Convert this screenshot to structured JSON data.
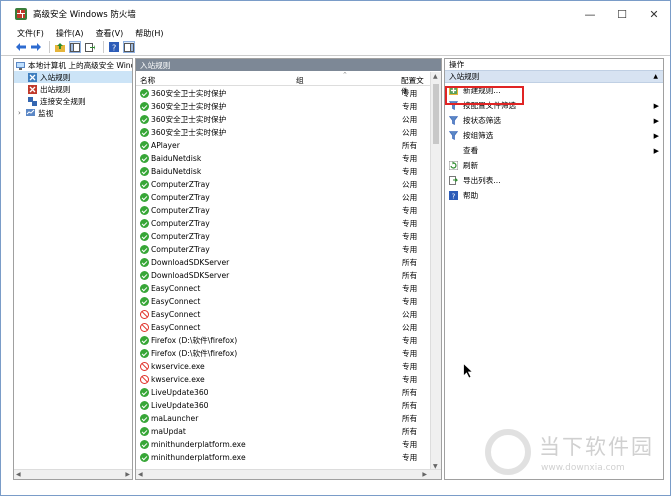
{
  "window": {
    "title": "高级安全 Windows 防火墙",
    "minimize": "—",
    "maximize": "☐",
    "close": "✕"
  },
  "menu": [
    "文件(F)",
    "操作(A)",
    "查看(V)",
    "帮助(H)"
  ],
  "tree": {
    "root": "本地计算机 上的高级安全 Windows",
    "items": [
      "入站规则",
      "出站规则",
      "连接安全规则",
      "监视"
    ]
  },
  "center": {
    "header": "入站规则",
    "columns": {
      "name": "名称",
      "group": "组",
      "profile": "配置文件"
    },
    "rows": [
      {
        "name": "360安全卫士实时保护",
        "profile": "专用",
        "status": "ok"
      },
      {
        "name": "360安全卫士实时保护",
        "profile": "专用",
        "status": "ok"
      },
      {
        "name": "360安全卫士实时保护",
        "profile": "公用",
        "status": "ok"
      },
      {
        "name": "360安全卫士实时保护",
        "profile": "公用",
        "status": "ok"
      },
      {
        "name": "APlayer",
        "profile": "所有",
        "status": "ok"
      },
      {
        "name": "BaiduNetdisk",
        "profile": "专用",
        "status": "ok"
      },
      {
        "name": "BaiduNetdisk",
        "profile": "专用",
        "status": "ok"
      },
      {
        "name": "ComputerZTray",
        "profile": "公用",
        "status": "ok"
      },
      {
        "name": "ComputerZTray",
        "profile": "公用",
        "status": "ok"
      },
      {
        "name": "ComputerZTray",
        "profile": "专用",
        "status": "ok"
      },
      {
        "name": "ComputerZTray",
        "profile": "专用",
        "status": "ok"
      },
      {
        "name": "ComputerZTray",
        "profile": "专用",
        "status": "ok"
      },
      {
        "name": "ComputerZTray",
        "profile": "专用",
        "status": "ok"
      },
      {
        "name": "DownloadSDKServer",
        "profile": "所有",
        "status": "ok"
      },
      {
        "name": "DownloadSDKServer",
        "profile": "所有",
        "status": "ok"
      },
      {
        "name": "EasyConnect",
        "profile": "专用",
        "status": "ok"
      },
      {
        "name": "EasyConnect",
        "profile": "专用",
        "status": "ok"
      },
      {
        "name": "EasyConnect",
        "profile": "公用",
        "status": "block"
      },
      {
        "name": "EasyConnect",
        "profile": "公用",
        "status": "block"
      },
      {
        "name": "Firefox (D:\\软件\\firefox)",
        "profile": "专用",
        "status": "ok"
      },
      {
        "name": "Firefox (D:\\软件\\firefox)",
        "profile": "专用",
        "status": "ok"
      },
      {
        "name": "kwservice.exe",
        "profile": "专用",
        "status": "block"
      },
      {
        "name": "kwservice.exe",
        "profile": "专用",
        "status": "block"
      },
      {
        "name": "LiveUpdate360",
        "profile": "所有",
        "status": "ok"
      },
      {
        "name": "LiveUpdate360",
        "profile": "所有",
        "status": "ok"
      },
      {
        "name": "maLauncher",
        "profile": "所有",
        "status": "ok"
      },
      {
        "name": "maUpdat",
        "profile": "所有",
        "status": "ok"
      },
      {
        "name": "minithunderplatform.exe",
        "profile": "专用",
        "status": "ok"
      },
      {
        "name": "minithunderplatform.exe",
        "profile": "专用",
        "status": "ok"
      }
    ]
  },
  "actions": {
    "header": "操作",
    "section": "入站规则",
    "items": [
      {
        "label": "新建规则...",
        "icon": "new-rule-icon",
        "submenu": false
      },
      {
        "label": "按配置文件筛选",
        "icon": "filter-icon",
        "submenu": true
      },
      {
        "label": "按状态筛选",
        "icon": "filter-icon",
        "submenu": true
      },
      {
        "label": "按组筛选",
        "icon": "filter-icon",
        "submenu": true
      },
      {
        "label": "查看",
        "icon": "",
        "submenu": true
      },
      {
        "label": "刷新",
        "icon": "refresh-icon",
        "submenu": false
      },
      {
        "label": "导出列表...",
        "icon": "export-icon",
        "submenu": false
      },
      {
        "label": "帮助",
        "icon": "help-icon",
        "submenu": false
      }
    ]
  },
  "watermark": {
    "title": "当下软件园",
    "url": "www.downxia.com"
  },
  "colors": {
    "pane_header": "#7d8896",
    "action_section": "#d7e3f2",
    "highlight": "#e02424",
    "allow": "#37a637",
    "block": "#e0322a"
  }
}
